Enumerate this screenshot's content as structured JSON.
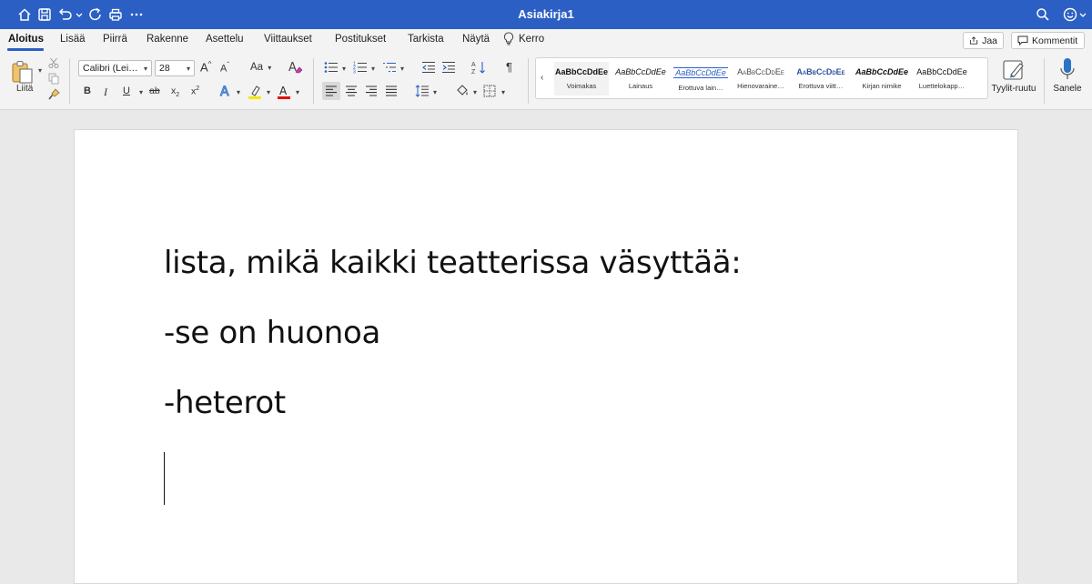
{
  "titlebar": {
    "doc_title": "Asiakirja1",
    "left_icons": [
      "home-icon",
      "save-icon",
      "undo-icon",
      "redo-icon",
      "print-icon",
      "more-icon"
    ],
    "right_icons": [
      "search-icon",
      "smiley-icon"
    ]
  },
  "tabs": [
    {
      "label": "Aloitus",
      "active": true
    },
    {
      "label": "Lisää"
    },
    {
      "label": "Piirrä"
    },
    {
      "label": "Rakenne"
    },
    {
      "label": "Asettelu"
    },
    {
      "label": "Viittaukset"
    },
    {
      "label": "Postitukset"
    },
    {
      "label": "Tarkista"
    },
    {
      "label": "Näytä"
    },
    {
      "label": "Kerro"
    }
  ],
  "share": {
    "label": "Jaa"
  },
  "comments": {
    "label": "Kommentit"
  },
  "ribbon": {
    "paste_label": "Liitä",
    "font_name": "Calibri (Lei…",
    "font_size": "28",
    "grow_font": "A",
    "shrink_font": "A",
    "change_case": "Aa",
    "bold": "B",
    "italic": "I",
    "underline": "U",
    "strike": "ab",
    "subscript": "x",
    "superscript": "x",
    "styles": [
      {
        "preview": "AaBbCcDdEe",
        "name": "Voimakas"
      },
      {
        "preview": "AaBbCcDdEe",
        "name": "Lainaus"
      },
      {
        "preview": "AaBbCcDdEe",
        "name": "Erottuva lain…"
      },
      {
        "preview": "AaBbCcDdEe",
        "name": "Hienovaraine…"
      },
      {
        "preview": "AaBbCcDdEe",
        "name": "Erottuva viitt…"
      },
      {
        "preview": "AaBbCcDdEe",
        "name": "Kirjan nimike"
      },
      {
        "preview": "AaBbCcDdEe",
        "name": "Luettelokapp…"
      }
    ],
    "styles_pane_label": "Tyylit-ruutu",
    "dictate_label": "Sanele",
    "accent_color": "#2b5fc4",
    "highlight_color": "#f5e800",
    "font_color": "#e01010"
  },
  "document": {
    "lines": [
      "lista, mikä kaikki teatterissa väsyttää:",
      "-se on huonoa",
      "-heterot"
    ]
  }
}
